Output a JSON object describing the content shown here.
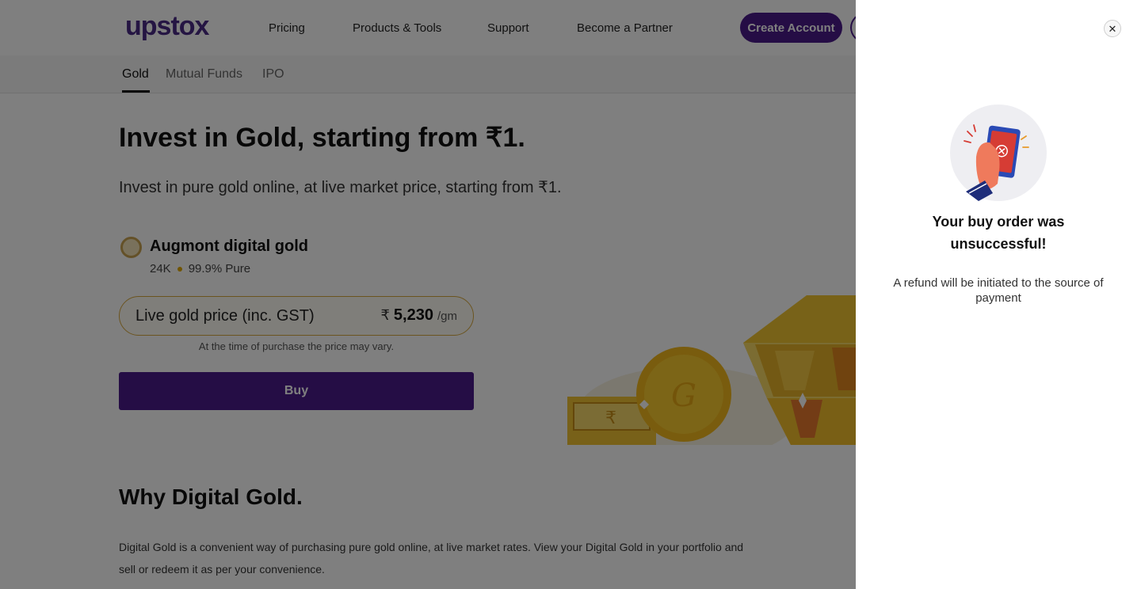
{
  "header": {
    "logo": "upstox",
    "nav": [
      "Pricing",
      "Products & Tools",
      "Support",
      "Become a Partner"
    ],
    "create_account": "Create Account"
  },
  "subnav": {
    "tabs": [
      "Gold",
      "Mutual Funds",
      "IPO"
    ],
    "active_tab": "Gold"
  },
  "hero": {
    "title": "Invest in Gold, starting from ₹1.",
    "subtitle": "Invest in pure gold online, at live market price, starting from ₹1.",
    "product": {
      "name": "Augmont digital gold",
      "purity_karat": "24K",
      "purity_percent": "99.9% Pure"
    },
    "price": {
      "label": "Live gold price (inc. GST)",
      "currency": "₹",
      "value": "5,230",
      "unit": "/gm",
      "note": "At the time of purchase the price may vary."
    },
    "buy_label": "Buy"
  },
  "why": {
    "title": "Why Digital Gold.",
    "text": "Digital Gold is a convenient way of purchasing pure gold online, at live market rates. View your Digital Gold in your portfolio and sell or redeem it as per your convenience."
  },
  "drawer": {
    "close_icon": "close-icon",
    "illustration": "failed-payment-phone-icon",
    "title": "Your buy order was unsuccessful!",
    "message": "A refund will be initiated to the source of payment"
  },
  "colors": {
    "brand_purple": "#4a1b8a",
    "gold": "#d7a83f",
    "overlay": "rgba(0,0,0,0.5)"
  }
}
